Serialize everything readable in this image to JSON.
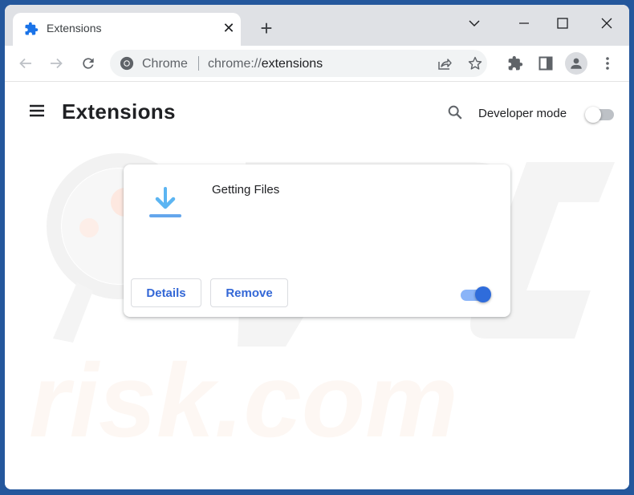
{
  "browser": {
    "tab": {
      "title": "Extensions",
      "icon": "puzzle-icon"
    },
    "new_tab_label": "+",
    "window_controls": [
      "tab-search",
      "minimize",
      "maximize",
      "close"
    ],
    "omnibox": {
      "site_label": "Chrome",
      "url_prefix": "chrome://",
      "url_path": "extensions"
    }
  },
  "page": {
    "title": "Extensions",
    "developer_mode": {
      "label": "Developer mode",
      "enabled": false
    }
  },
  "extensions": [
    {
      "name": "Getting Files",
      "icon": "download-icon",
      "enabled": true,
      "details_label": "Details",
      "remove_label": "Remove"
    }
  ],
  "colors": {
    "accent": "#3367d6",
    "toggle_on": "#2f6cdb",
    "frame": "#24579c",
    "tabstrip": "#dfe1e5"
  },
  "watermark": {
    "text": "risk.com"
  }
}
